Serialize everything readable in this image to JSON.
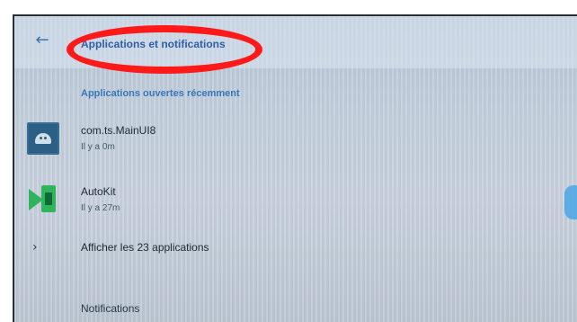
{
  "header": {
    "title": "Applications et notifications",
    "back_icon": "arrow-left-icon"
  },
  "recent_section": {
    "label": "Applications ouvertes récemment",
    "apps": [
      {
        "name": "com.ts.MainUI8",
        "time": "Il y a 0m",
        "icon": "android-icon"
      },
      {
        "name": "AutoKit",
        "time": "Il y a 27m",
        "icon": "autokit-icon"
      }
    ]
  },
  "show_all": {
    "label": "Afficher les 23 applications",
    "icon": "chevron-right-icon"
  },
  "notifications": {
    "label": "Notifications"
  },
  "colors": {
    "accent": "#3a77b6",
    "highlight_circle": "#ff1a1a",
    "autokit_green": "#2fb35b"
  }
}
